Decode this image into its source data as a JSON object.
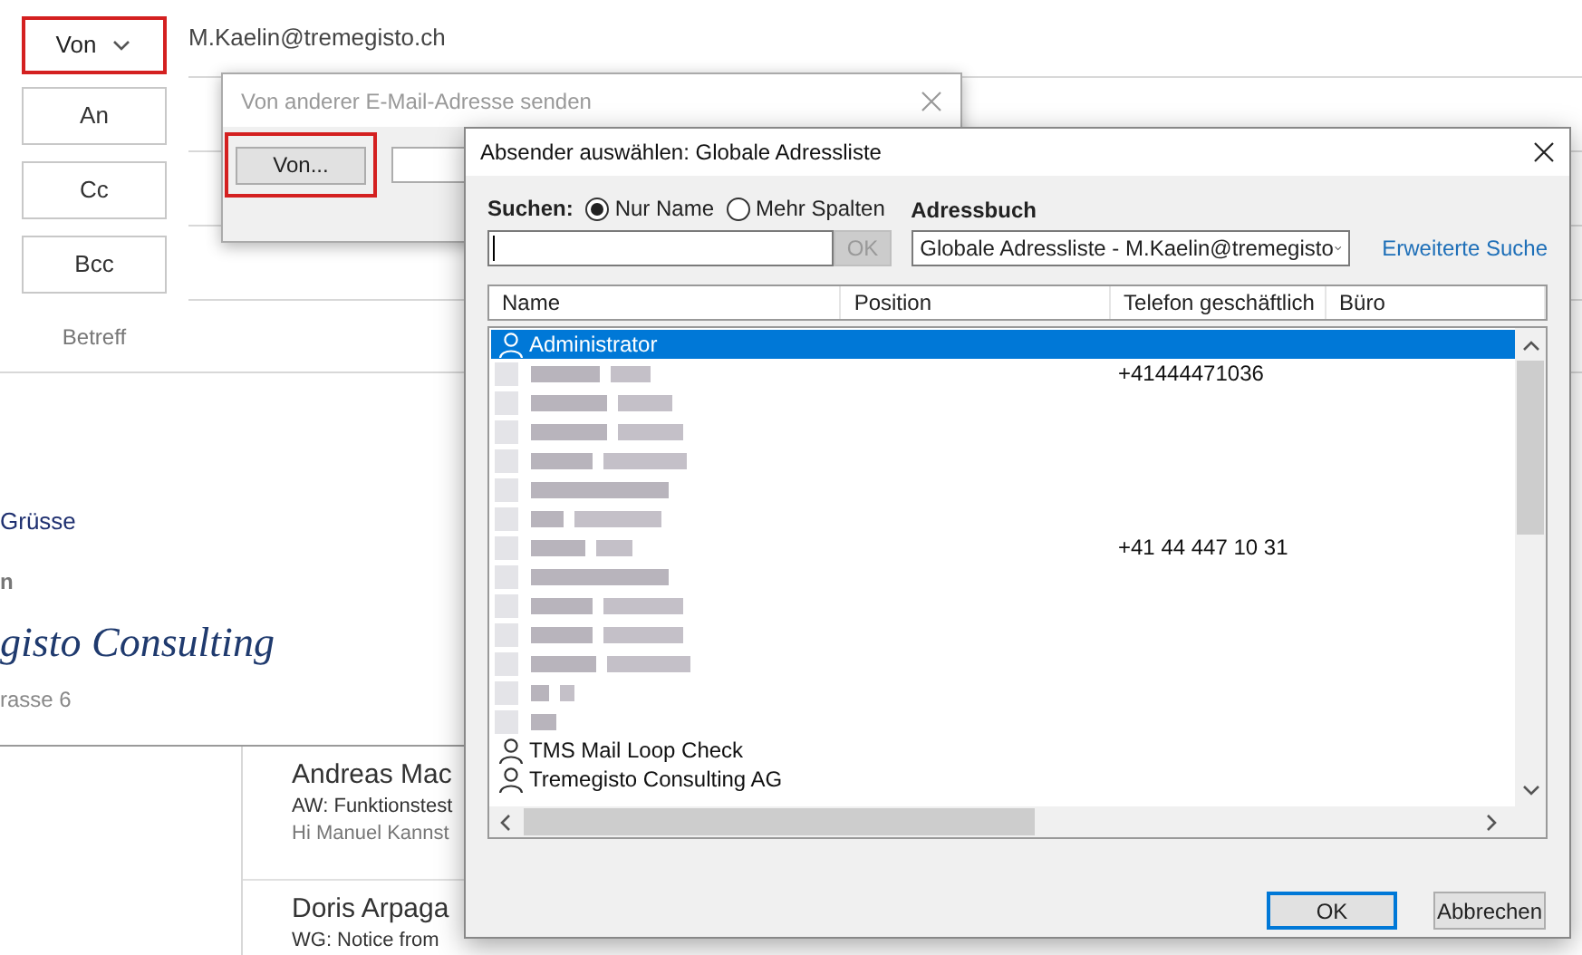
{
  "compose": {
    "from_button": "Von",
    "from_address": "M.Kaelin@tremegisto.ch",
    "recipient_buttons": [
      "An",
      "Cc",
      "Bcc"
    ],
    "subject_label": "Betreff"
  },
  "body": {
    "greeting": "Grüsse",
    "name_fragment": "n",
    "company": "gisto Consulting",
    "street": "rasse 6"
  },
  "messages": [
    {
      "sender": "Andreas Mac",
      "subject": "AW: Funktionstest",
      "preview": "Hi Manuel  Kannst"
    },
    {
      "sender": "Doris Arpaga",
      "subject": "WG: Notice from"
    }
  ],
  "send_as_dialog": {
    "title": "Von anderer E-Mail-Adresse senden",
    "from_button": "Von..."
  },
  "address_dialog": {
    "title": "Absender auswählen: Globale Adressliste",
    "search_label": "Suchen:",
    "search_modes": [
      {
        "label": "Nur Name",
        "selected": true
      },
      {
        "label": "Mehr Spalten",
        "selected": false
      }
    ],
    "search_ok": {
      "label": "OK",
      "disabled": true
    },
    "address_book_label": "Adressbuch",
    "address_book": "Globale Adressliste - M.Kaelin@tremegisto",
    "advanced_link": "Erweiterte Suche",
    "columns": [
      "Name",
      "Position",
      "Telefon geschäftlich",
      "Büro"
    ],
    "rows": [
      {
        "kind": "contact",
        "name": "Administrator",
        "selected": true
      },
      {
        "kind": "redacted",
        "phone": "+41444471036",
        "selected": false
      },
      {
        "kind": "redacted",
        "selected": false
      },
      {
        "kind": "redacted",
        "selected": false
      },
      {
        "kind": "redacted",
        "selected": false
      },
      {
        "kind": "redacted",
        "selected": false
      },
      {
        "kind": "redacted",
        "selected": false
      },
      {
        "kind": "redacted",
        "phone": "+41 44 447 10 31",
        "selected": false
      },
      {
        "kind": "redacted",
        "selected": false
      },
      {
        "kind": "redacted",
        "selected": false
      },
      {
        "kind": "redacted",
        "selected": false
      },
      {
        "kind": "redacted",
        "selected": false
      },
      {
        "kind": "redacted",
        "selected": false
      },
      {
        "kind": "redacted",
        "selected": false
      },
      {
        "kind": "contact",
        "name": "TMS Mail Loop Check",
        "selected": false
      },
      {
        "kind": "contact",
        "name": "Tremegisto Consulting AG",
        "selected": false
      }
    ],
    "buttons": [
      {
        "label": "OK",
        "default": true
      },
      {
        "label": "Abbrechen",
        "default": false
      }
    ]
  }
}
